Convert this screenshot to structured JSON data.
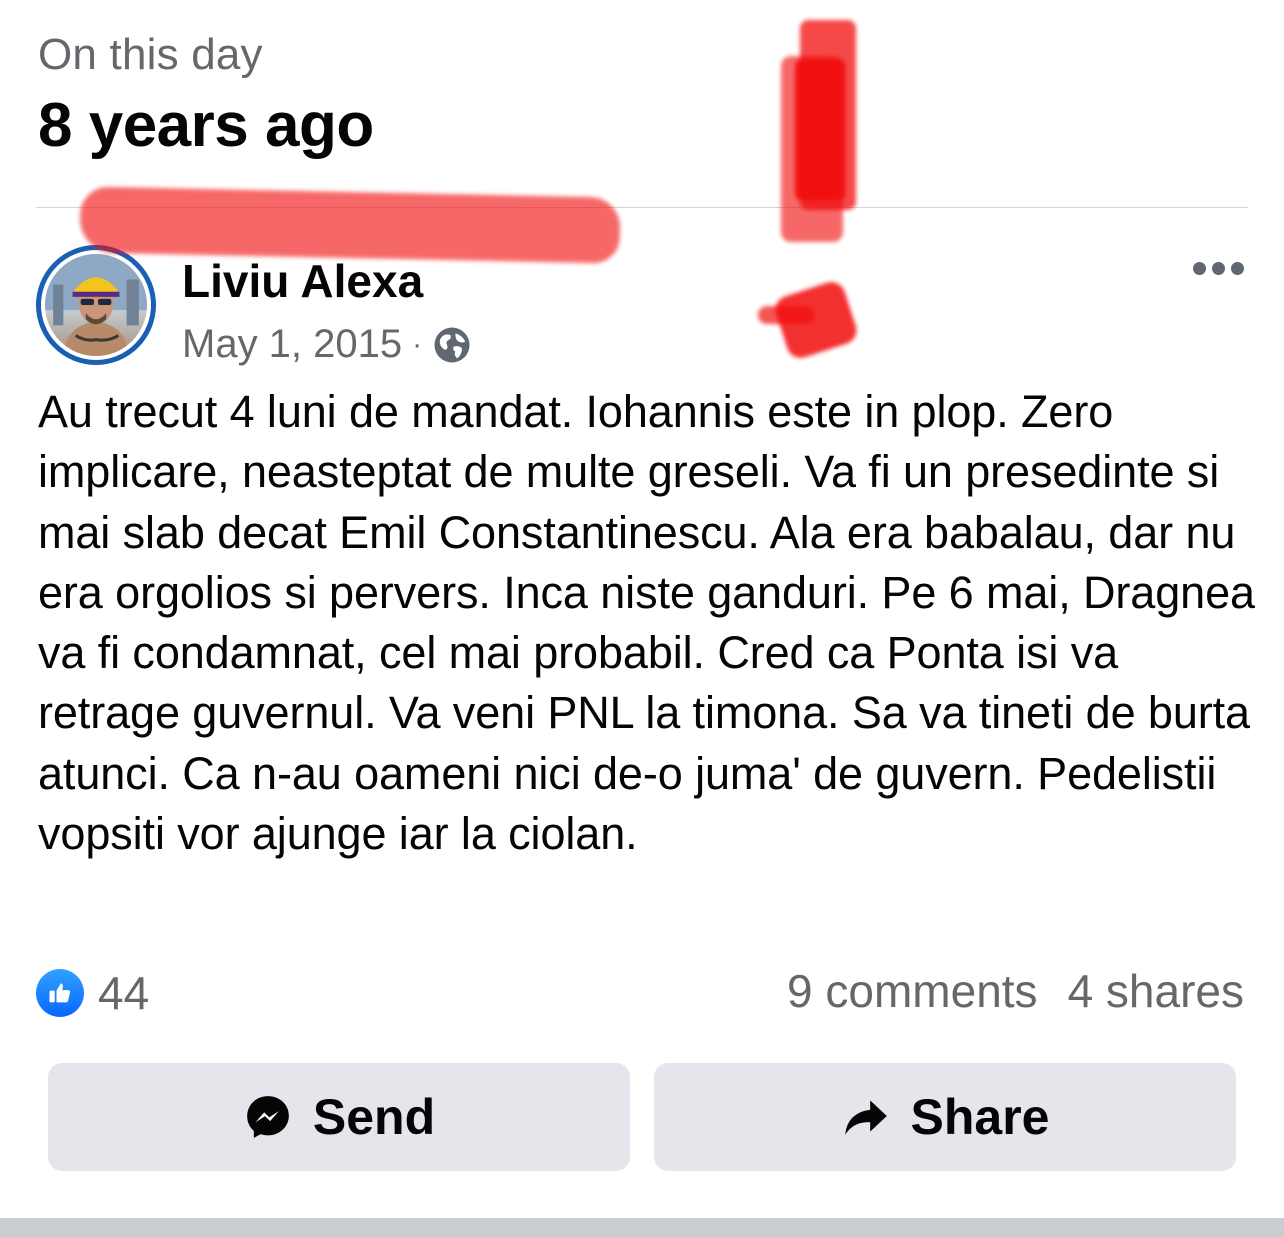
{
  "memory": {
    "label": "On this day",
    "years_ago": "8 years ago"
  },
  "post": {
    "author": "Liviu Alexa",
    "date": "May 1, 2015",
    "separator": "·",
    "privacy_icon": "globe-icon",
    "more_icon": "more-options-icon",
    "text": "Au trecut 4 luni de mandat. Iohannis este in plop. Zero implicare, neasteptat de multe greseli. Va fi un presedinte si mai slab decat Emil Constantinescu. Ala era babalau, dar nu era orgolios si pervers. Inca niste ganduri. Pe 6 mai, Dragnea va fi condamnat, cel mai probabil. Cred ca Ponta isi va retrage guvernul. Va veni PNL la timona. Sa va tineti de burta atunci. Ca n-au oameni nici de-o juma' de guvern. Pedelistii vopsiti vor ajunge iar la ciolan."
  },
  "engagement": {
    "reaction_icon": "like-icon",
    "likes": "44",
    "comments": "9 comments",
    "shares": "4 shares"
  },
  "actions": {
    "send_label": "Send",
    "send_icon": "messenger-icon",
    "share_label": "Share",
    "share_icon": "share-arrow-icon"
  },
  "colors": {
    "accent": "#0866ff",
    "avatar_ring": "#1b5fb3",
    "secondary_text": "#65676b",
    "button_bg": "#e4e6eb",
    "annotation_red": "#f20d0d"
  }
}
